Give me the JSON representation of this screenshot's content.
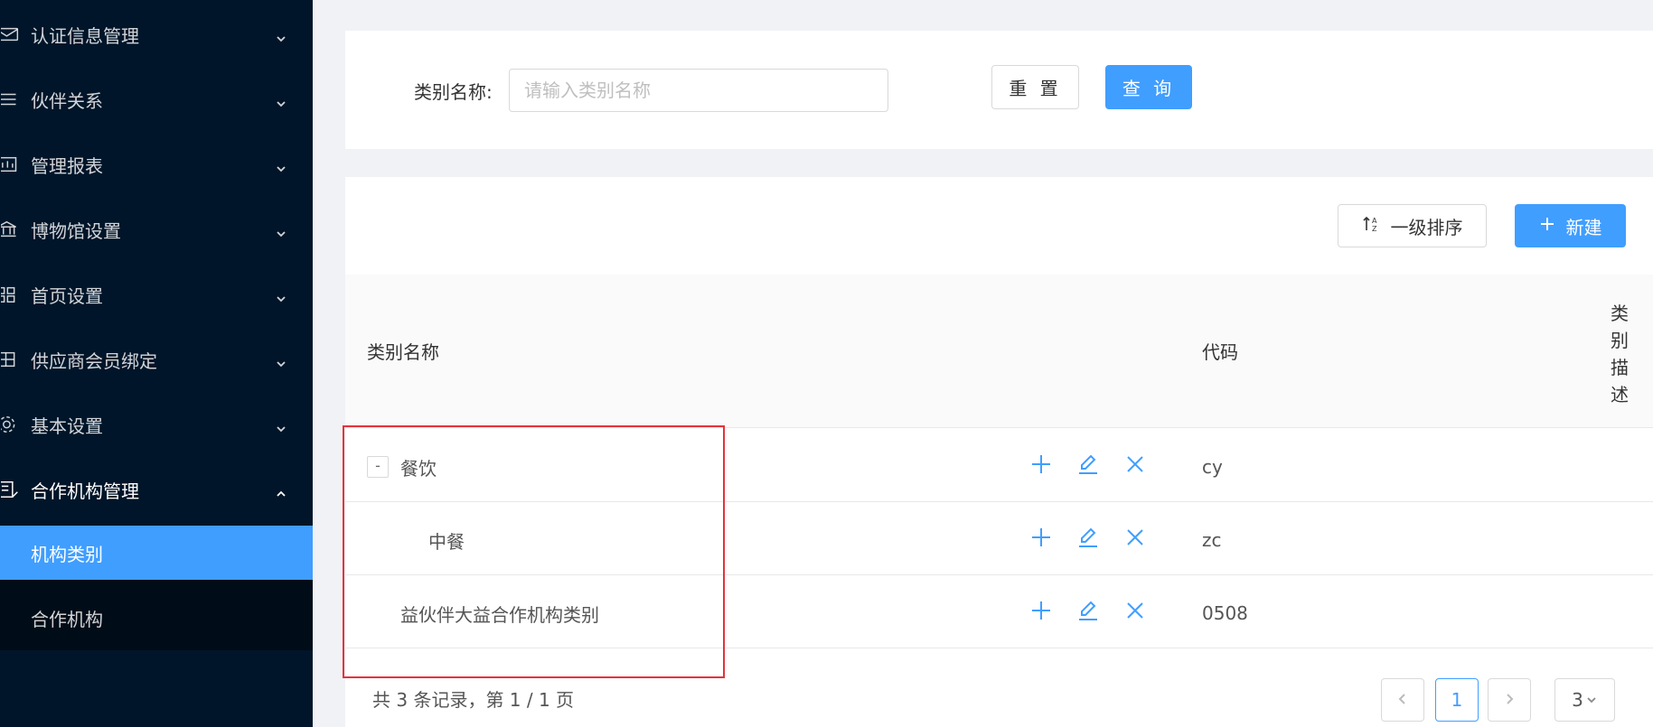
{
  "sidebar": {
    "menus": [
      {
        "label": "认证信息管理",
        "icon": "mail-icon",
        "state": "collapsed"
      },
      {
        "label": "伙伴关系",
        "icon": "list-icon",
        "state": "collapsed"
      },
      {
        "label": "管理报表",
        "icon": "report-icon",
        "state": "collapsed"
      },
      {
        "label": "博物馆设置",
        "icon": "museum-icon",
        "state": "collapsed"
      },
      {
        "label": "首页设置",
        "icon": "grid-icon",
        "state": "collapsed"
      },
      {
        "label": "供应商会员绑定",
        "icon": "link-icon",
        "state": "collapsed"
      },
      {
        "label": "基本设置",
        "icon": "gear-icon",
        "state": "collapsed"
      },
      {
        "label": "合作机构管理",
        "icon": "building-icon",
        "state": "expanded"
      }
    ],
    "submenu": [
      {
        "label": "机构类别",
        "active": true
      },
      {
        "label": "合作机构",
        "active": false
      }
    ]
  },
  "search": {
    "label": "类别名称:",
    "placeholder": "请输入类别名称",
    "value": "",
    "reset_label": "重 置",
    "query_label": "查 询"
  },
  "toolbar": {
    "sort_label": "一级排序",
    "sort_icon": "sort-az-icon",
    "new_label": "新建",
    "new_icon": "plus-icon"
  },
  "table": {
    "headers": {
      "name": "类别名称",
      "code": "代码",
      "desc": "类别描述"
    },
    "rows": [
      {
        "name": "餐饮",
        "code": "cy",
        "level": 0,
        "expander": "-"
      },
      {
        "name": "中餐",
        "code": "zc",
        "level": 1,
        "expander": ""
      },
      {
        "name": "益伙伴大益合作机构类别",
        "code": "0508",
        "level": 0,
        "expander": ""
      }
    ],
    "row_actions": [
      "plus-icon",
      "edit-icon",
      "close-icon"
    ]
  },
  "pagination": {
    "summary": "共 3 条记录，第 1 / 1 页",
    "current_page": "1",
    "page_size": "3"
  },
  "colors": {
    "sidebar_bg": "#001529",
    "submenu_bg": "#000c17",
    "primary": "#409eff",
    "highlight": "#e6323c"
  }
}
